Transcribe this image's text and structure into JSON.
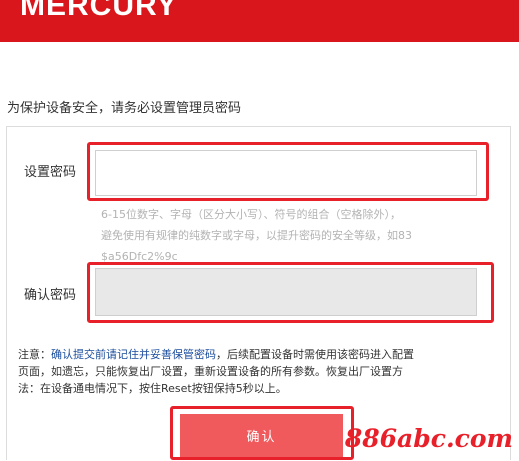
{
  "header": {
    "brand": "MERCURY",
    "bg_color": "#d9161c"
  },
  "intro_text": "为保护设备安全，请务必设置管理员密码",
  "form": {
    "password_label": "设置密码",
    "password_value": "",
    "hint_lines": [
      "6-15位数字、字母（区分大小写）、符号的组合（空格除外），",
      "避免使用有规律的纯数字或字母，以提升密码的安全等级，如83",
      "$a56Dfc2%9c"
    ],
    "confirm_label": "确认密码",
    "confirm_value": ""
  },
  "note": {
    "prefix": "注意：",
    "highlight": "确认提交前请记住并妥善保管密码",
    "line1_rest": "，后续配置设备时需使用该密码进入配置",
    "line2": "页面，如遗忘，只能恢复出厂设置，重新设置设备的所有参数。恢复出厂设置方",
    "line3": "法：在设备通电情况下，按住Reset按钮保持5秒以上。"
  },
  "button": {
    "confirm_label": "确认",
    "color": "#f05a5d"
  },
  "highlight_color": "#e8202a",
  "watermark": "886abc.com"
}
